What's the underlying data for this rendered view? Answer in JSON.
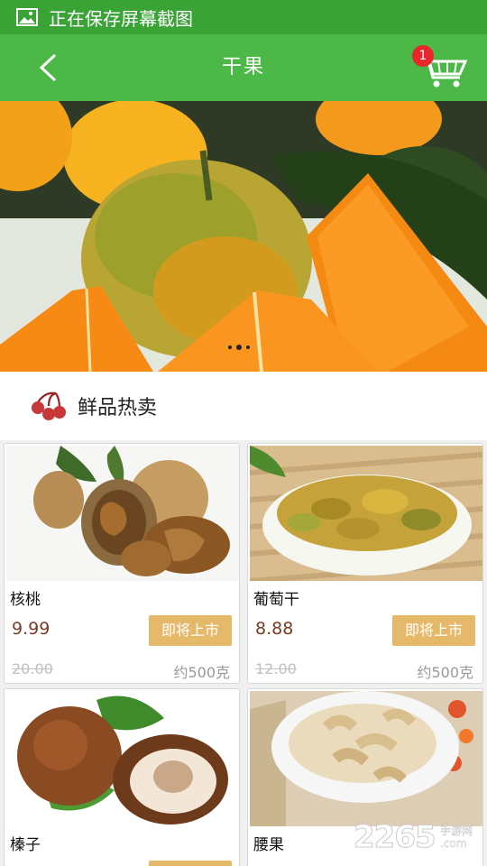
{
  "status_bar": {
    "text": "正在保存屏幕截图",
    "icon": "image-icon"
  },
  "header": {
    "title": "干果",
    "back_icon": "chevron-left-icon",
    "cart_icon": "shopping-cart-icon",
    "cart_count": "1"
  },
  "banner": {
    "slide_count": 3,
    "active_slide": 2
  },
  "section": {
    "title": "鲜品热卖",
    "icon": "cherry-icon"
  },
  "products": [
    {
      "name": "核桃",
      "price": "9.99",
      "button": "即将上市",
      "old_price": "20.00",
      "weight": "约500克"
    },
    {
      "name": "葡萄干",
      "price": "8.88",
      "button": "即将上市",
      "old_price": "12.00",
      "weight": "约500克"
    },
    {
      "name": "榛子",
      "price": "",
      "button": "",
      "old_price": "",
      "weight": ""
    },
    {
      "name": "腰果",
      "price": "",
      "button": "",
      "old_price": "",
      "weight": ""
    }
  ],
  "watermark": {
    "number": "2265",
    "suffix": ".com",
    "cn": "手游网"
  },
  "colors": {
    "status_bar": "#3aa336",
    "app_bar": "#4cb847",
    "badge": "#e8262b",
    "button": "#e6b96a",
    "price": "#7a3b23"
  }
}
